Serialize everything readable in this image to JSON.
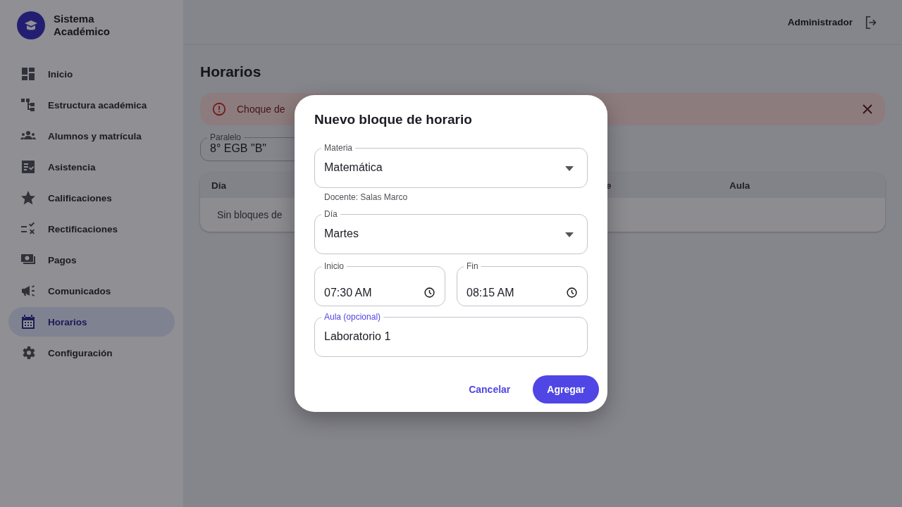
{
  "brand": {
    "name": "Sistema Académico"
  },
  "sidebar": {
    "items": [
      {
        "label": "Inicio",
        "selected": false
      },
      {
        "label": "Estructura académica",
        "selected": false
      },
      {
        "label": "Alumnos y matrícula",
        "selected": false
      },
      {
        "label": "Asistencia",
        "selected": false
      },
      {
        "label": "Calificaciones",
        "selected": false
      },
      {
        "label": "Rectificaciones",
        "selected": false
      },
      {
        "label": "Pagos",
        "selected": false
      },
      {
        "label": "Comunicados",
        "selected": false
      },
      {
        "label": "Horarios",
        "selected": true
      },
      {
        "label": "Configuración",
        "selected": false
      }
    ]
  },
  "header": {
    "user": "Administrador"
  },
  "page": {
    "title": "Horarios",
    "alert": {
      "message": "Choque de"
    },
    "paralelo": {
      "label": "Paralelo",
      "value": "8° EGB \"B\""
    },
    "table": {
      "columns": [
        {
          "label": "Día"
        },
        {
          "label": "e"
        },
        {
          "label": "Aula"
        }
      ],
      "empty_message": "Sin bloques de"
    }
  },
  "dialog": {
    "title": "Nuevo bloque de horario",
    "materia": {
      "label": "Materia",
      "value": "Matemática",
      "helper": "Docente: Salas Marco"
    },
    "dia": {
      "label": "Día",
      "value": "Martes"
    },
    "inicio": {
      "label": "Inicio",
      "value": "07:30 AM"
    },
    "fin": {
      "label": "Fin",
      "value": "08:15 AM"
    },
    "aula": {
      "label": "Aula (opcional)",
      "value": "Laboratorio 1",
      "focused": true
    },
    "buttons": [
      {
        "label": "Cancelar",
        "kind": "text"
      },
      {
        "label": "Agregar",
        "kind": "primary"
      }
    ]
  }
}
